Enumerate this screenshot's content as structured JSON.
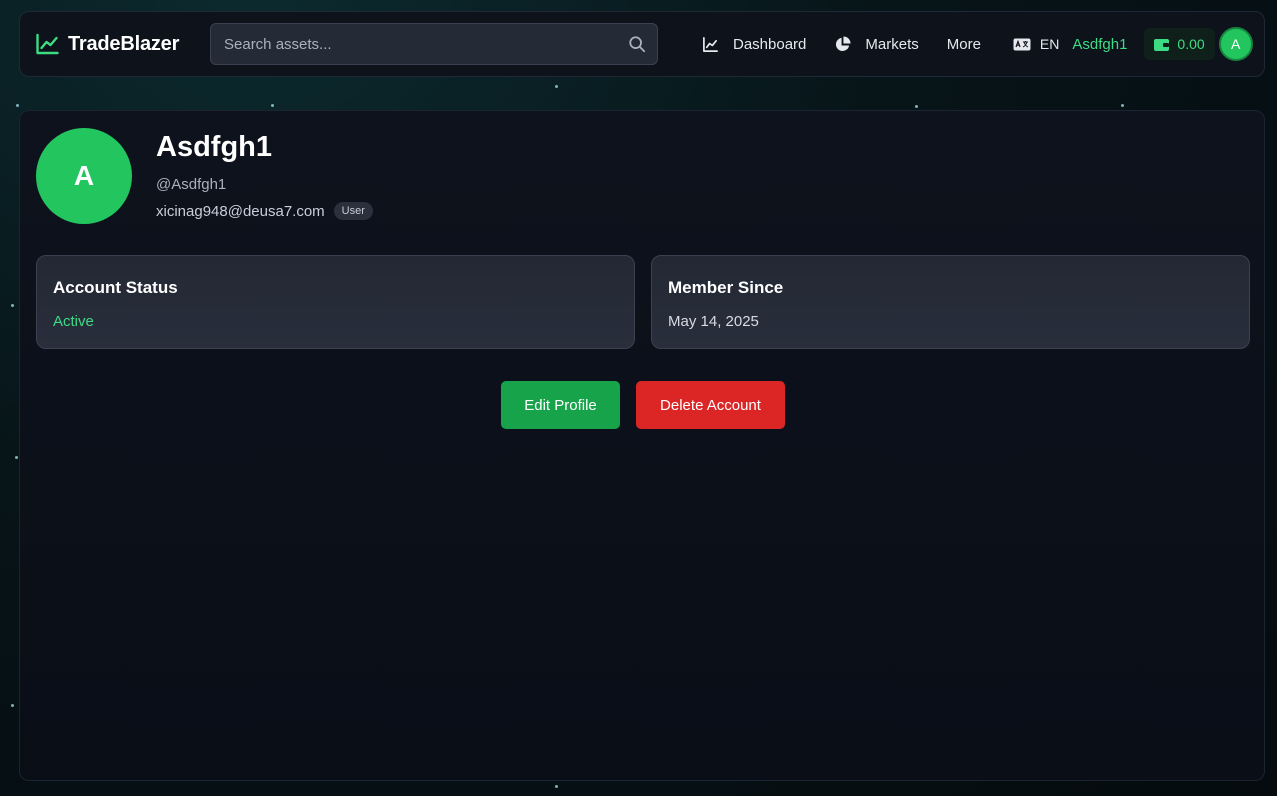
{
  "app": {
    "name": "TradeBlazer"
  },
  "search": {
    "placeholder": "Search assets..."
  },
  "nav": {
    "dashboard": "Dashboard",
    "markets": "Markets",
    "more": "More"
  },
  "language": {
    "code": "EN"
  },
  "user": {
    "username": "Asdfgh1",
    "avatar_initial": "A"
  },
  "wallet": {
    "balance": "0.00"
  },
  "profile": {
    "name": "Asdfgh1",
    "handle": "@Asdfgh1",
    "email": "xicinag948@deusa7.com",
    "role": "User",
    "avatar_initial": "A"
  },
  "cards": {
    "status": {
      "title": "Account Status",
      "value": "Active"
    },
    "member": {
      "title": "Member Since",
      "value": "May 14, 2025"
    }
  },
  "actions": {
    "edit": "Edit Profile",
    "delete": "Delete Account"
  },
  "colors": {
    "accent_green": "#22c55e",
    "status_active": "#3ddc84",
    "danger_red": "#dc2626",
    "panel_bg": "#0e121c"
  },
  "icons": {
    "brand": "trending-chart-icon",
    "search": "search-icon",
    "dashboard": "line-chart-icon",
    "markets": "pie-chart-icon",
    "language": "translate-icon",
    "wallet": "wallet-icon"
  }
}
